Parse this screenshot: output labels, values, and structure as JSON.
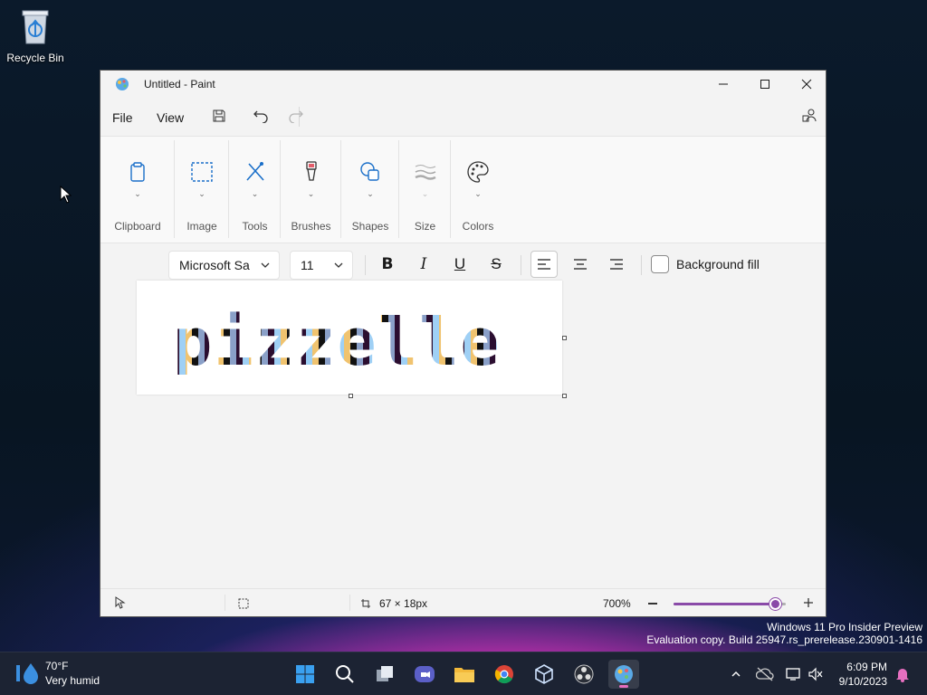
{
  "desktop": {
    "recycle_bin_label": "Recycle Bin"
  },
  "window": {
    "title": "Untitled - Paint",
    "menu": {
      "file": "File",
      "view": "View"
    }
  },
  "ribbon": {
    "groups": [
      {
        "label": "Clipboard",
        "icon": "clipboard-icon"
      },
      {
        "label": "Image",
        "icon": "selection-icon"
      },
      {
        "label": "Tools",
        "icon": "tools-icon"
      },
      {
        "label": "Brushes",
        "icon": "brush-icon"
      },
      {
        "label": "Shapes",
        "icon": "shapes-icon"
      },
      {
        "label": "Size",
        "icon": "size-icon"
      },
      {
        "label": "Colors",
        "icon": "palette-icon"
      }
    ]
  },
  "text_toolbar": {
    "font_family": "Microsoft Sa",
    "font_size": "11",
    "background_fill_label": "Background fill",
    "background_fill_checked": false
  },
  "canvas": {
    "text": "pizzelle"
  },
  "status": {
    "canvas_size": "67 × 18px",
    "zoom": "700%",
    "zoom_slider_fraction": 0.9
  },
  "watermark": {
    "line1": "Windows 11 Pro Insider Preview",
    "line2": "Evaluation copy. Build 25947.rs_prerelease.230901-1416"
  },
  "taskbar": {
    "weather_temp": "70°F",
    "weather_condition": "Very humid",
    "time": "6:09 PM",
    "date": "9/10/2023",
    "apps": [
      "start-icon",
      "search-icon",
      "task-view-icon",
      "chat-icon",
      "file-explorer-icon",
      "chrome-icon",
      "virtualbox-icon",
      "obs-icon",
      "paint-icon"
    ],
    "accent": "#e76fc0"
  }
}
